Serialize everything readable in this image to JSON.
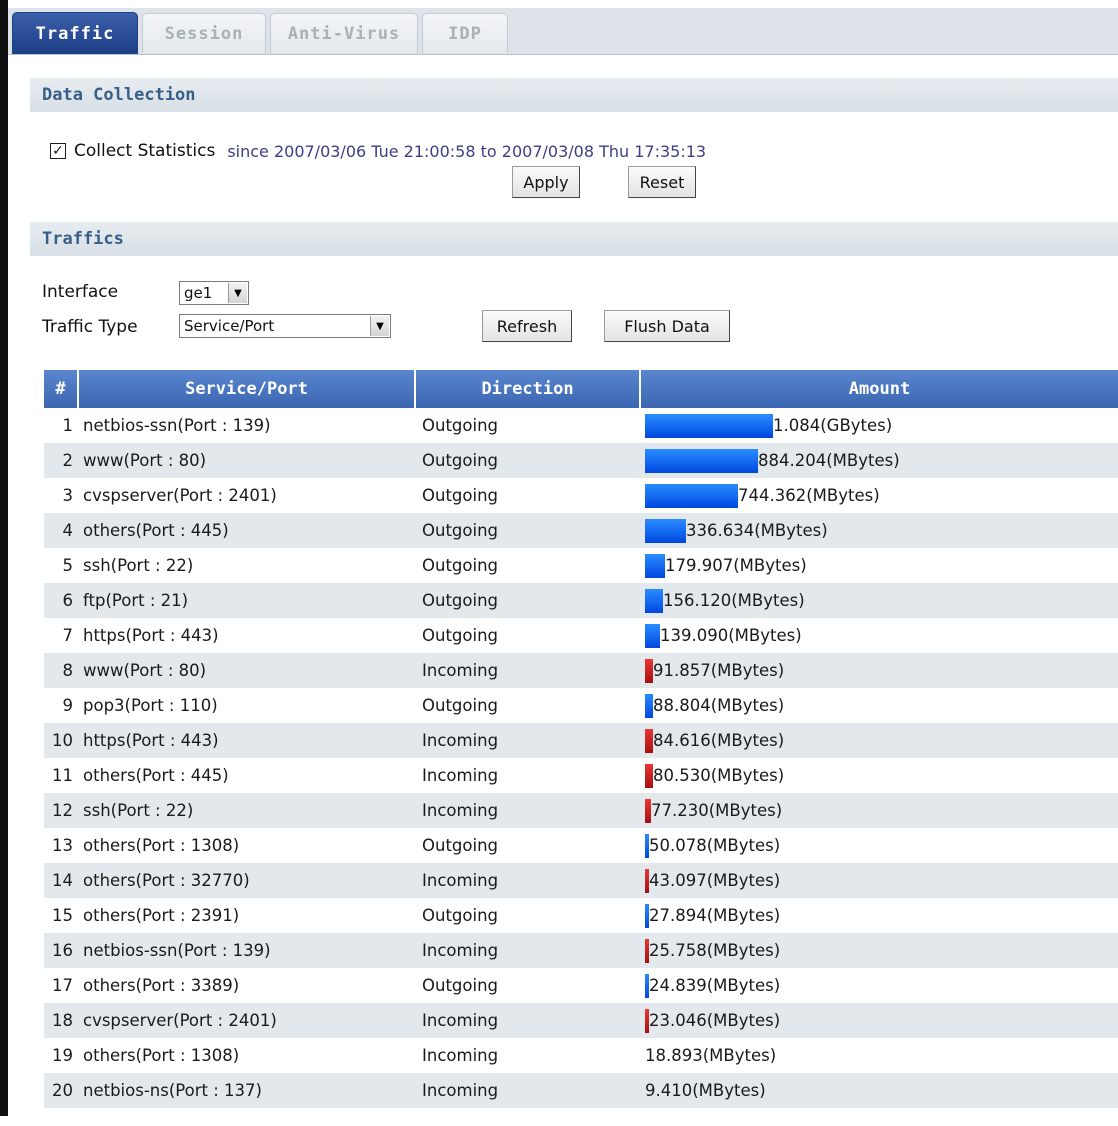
{
  "tabs": [
    {
      "label": "Traffic",
      "active": true
    },
    {
      "label": "Session",
      "active": false
    },
    {
      "label": "Anti-Virus",
      "active": false
    },
    {
      "label": "IDP",
      "active": false
    }
  ],
  "data_collection": {
    "title": "Data Collection",
    "collect_checked": true,
    "checkbox_mark": "✓",
    "collect_label": "Collect Statistics",
    "since_text": "since 2007/03/06 Tue 21:00:58 to 2007/03/08 Thu 17:35:13",
    "apply_label": "Apply",
    "reset_label": "Reset"
  },
  "traffics": {
    "title": "Traffics",
    "interface_label": "Interface",
    "interface_value": "ge1",
    "traffic_type_label": "Traffic Type",
    "traffic_type_value": "Service/Port",
    "refresh_label": "Refresh",
    "flush_label": "Flush Data"
  },
  "table": {
    "headers": {
      "num": "#",
      "service": "Service/Port",
      "direction": "Direction",
      "amount": "Amount"
    },
    "rows": [
      {
        "num": "1",
        "service": "netbios-ssn(Port : 139)",
        "direction": "Outgoing",
        "amount": "1.084(GBytes)",
        "share": 1.0
      },
      {
        "num": "2",
        "service": "www(Port : 80)",
        "direction": "Outgoing",
        "amount": "884.204(MBytes)",
        "share": 0.88
      },
      {
        "num": "3",
        "service": "cvspserver(Port : 2401)",
        "direction": "Outgoing",
        "amount": "744.362(MBytes)",
        "share": 0.73
      },
      {
        "num": "4",
        "service": "others(Port : 445)",
        "direction": "Outgoing",
        "amount": "336.634(MBytes)",
        "share": 0.32
      },
      {
        "num": "5",
        "service": "ssh(Port : 22)",
        "direction": "Outgoing",
        "amount": "179.907(MBytes)",
        "share": 0.16
      },
      {
        "num": "6",
        "service": "ftp(Port : 21)",
        "direction": "Outgoing",
        "amount": "156.120(MBytes)",
        "share": 0.14
      },
      {
        "num": "7",
        "service": "https(Port : 443)",
        "direction": "Outgoing",
        "amount": "139.090(MBytes)",
        "share": 0.12
      },
      {
        "num": "8",
        "service": "www(Port : 80)",
        "direction": "Incoming",
        "amount": "91.857(MBytes)",
        "share": 0.06
      },
      {
        "num": "9",
        "service": "pop3(Port : 110)",
        "direction": "Outgoing",
        "amount": "88.804(MBytes)",
        "share": 0.06
      },
      {
        "num": "10",
        "service": "https(Port : 443)",
        "direction": "Incoming",
        "amount": "84.616(MBytes)",
        "share": 0.06
      },
      {
        "num": "11",
        "service": "others(Port : 445)",
        "direction": "Incoming",
        "amount": "80.530(MBytes)",
        "share": 0.06
      },
      {
        "num": "12",
        "service": "ssh(Port : 22)",
        "direction": "Incoming",
        "amount": "77.230(MBytes)",
        "share": 0.05
      },
      {
        "num": "13",
        "service": "others(Port : 1308)",
        "direction": "Outgoing",
        "amount": "50.078(MBytes)",
        "share": 0.02
      },
      {
        "num": "14",
        "service": "others(Port : 32770)",
        "direction": "Incoming",
        "amount": "43.097(MBytes)",
        "share": 0.03
      },
      {
        "num": "15",
        "service": "others(Port : 2391)",
        "direction": "Outgoing",
        "amount": "27.894(MBytes)",
        "share": 0.02
      },
      {
        "num": "16",
        "service": "netbios-ssn(Port : 139)",
        "direction": "Incoming",
        "amount": "25.758(MBytes)",
        "share": 0.02
      },
      {
        "num": "17",
        "service": "others(Port : 3389)",
        "direction": "Outgoing",
        "amount": "24.839(MBytes)",
        "share": 0.02
      },
      {
        "num": "18",
        "service": "cvspserver(Port : 2401)",
        "direction": "Incoming",
        "amount": "23.046(MBytes)",
        "share": 0.02
      },
      {
        "num": "19",
        "service": "others(Port : 1308)",
        "direction": "Incoming",
        "amount": "18.893(MBytes)",
        "share": 0
      },
      {
        "num": "20",
        "service": "netbios-ns(Port : 137)",
        "direction": "Incoming",
        "amount": "9.410(MBytes)",
        "share": 0
      }
    ]
  }
}
